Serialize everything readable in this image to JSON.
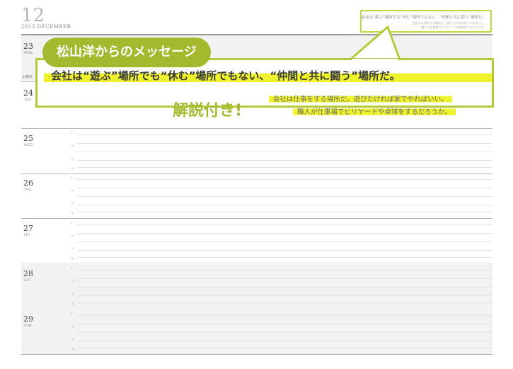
{
  "planner": {
    "month_number": "12",
    "month_label": "2013 DECEMBER",
    "header_note": {
      "line1": "会社は“遊ぶ”場所でも“休む”場所でもない、“仲間と共に闘う”場所だ。",
      "line2": "会社は仕事をする場所だ。遊びたければ家でやればいい。",
      "line3": "職人が仕事場でビリヤードや卓球をするだろうか。"
    },
    "side_tab": "火曜日",
    "days": [
      {
        "num": "23",
        "weekday": "MON"
      },
      {
        "num": "24",
        "weekday": "TUE"
      },
      {
        "num": "25",
        "weekday": "WED"
      },
      {
        "num": "26",
        "weekday": "THU"
      },
      {
        "num": "27",
        "weekday": "FRI"
      },
      {
        "num": "28",
        "weekday": "SAT"
      },
      {
        "num": "29",
        "weekday": "SUN"
      }
    ],
    "hour_marks": [
      "9",
      "12",
      "15",
      "18"
    ]
  },
  "callout": {
    "title": "松山洋からのメッセージ",
    "quote": "会社は“遊ぶ”場所でも“休む”場所でもない、“仲間と共に闘う”場所だ。",
    "commentary_tag": "解説付き!",
    "commentary_line1": "会社は仕事をする場所だ。遊びたければ家でやればいい。",
    "commentary_line2": "職人が仕事場でビリヤードや卓球をするだろうか。"
  },
  "colors": {
    "accent_green": "#a4b92e",
    "frame_green": "#b7c93a",
    "highlight_yellow": "#eef32b",
    "shaded_row": "#f2f2f2",
    "grid_line": "#e3e3e3"
  }
}
